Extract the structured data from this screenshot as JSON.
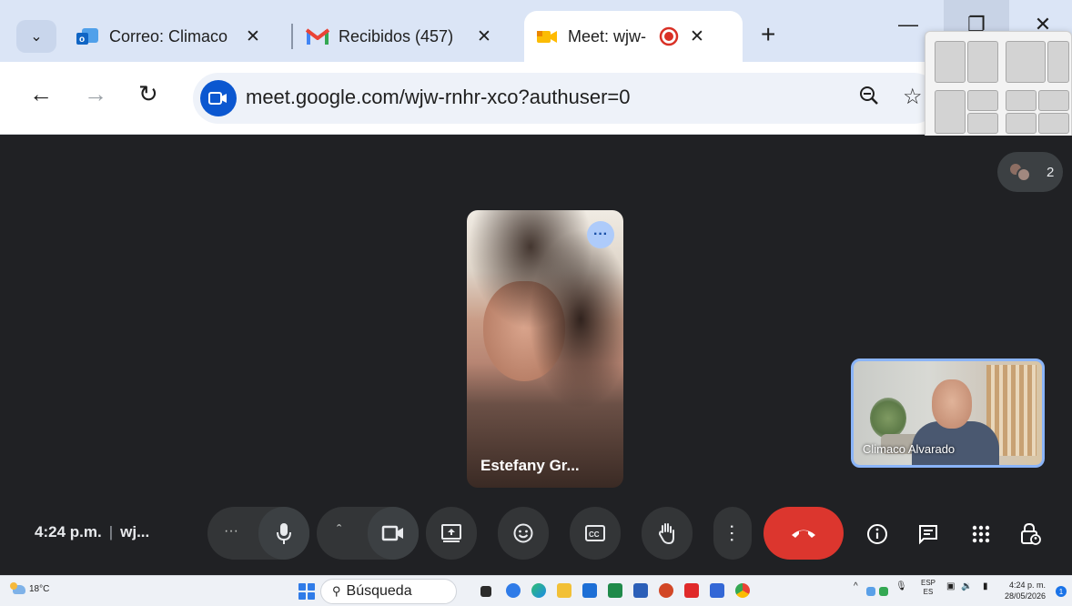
{
  "browser": {
    "tabs": [
      {
        "title": "Correo: Climaco",
        "favicon": "outlook-icon"
      },
      {
        "title": "Recibidos (457)",
        "favicon": "gmail-icon"
      },
      {
        "title": "Meet: wjw-",
        "favicon": "meet-icon",
        "active": true
      }
    ],
    "close_glyph": "✕",
    "new_tab_glyph": "+",
    "url": "meet.google.com/wjw-rnhr-xco?authuser=0"
  },
  "meet": {
    "people_count": "2",
    "main_tile_name": "Estefany Gr...",
    "self_tile_name": "Climaco Alvarado",
    "time": "4:24 p.m.",
    "meeting_code_short": "wj...",
    "separator": "|",
    "accent": "#8ab4f8",
    "hangup_color": "#dc362e"
  },
  "taskbar": {
    "weather": "18°C",
    "search_placeholder": "Búsqueda",
    "lang_top": "ESP",
    "lang_bottom": "ES",
    "clock_time": "4:24 p. m.",
    "clock_date": "28/05/2026",
    "notification_count": "1"
  }
}
